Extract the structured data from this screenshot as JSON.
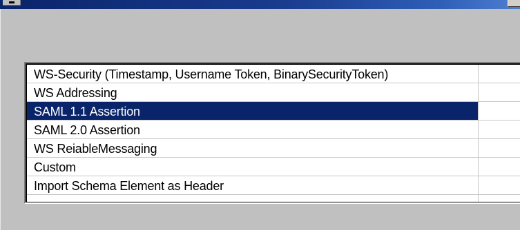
{
  "window": {
    "title_icon": "window-menu-icon"
  },
  "list": {
    "items": [
      {
        "label": "WS-Security (Timestamp, Username Token, BinarySecurityToken)",
        "selected": false
      },
      {
        "label": "WS Addressing",
        "selected": false
      },
      {
        "label": "SAML 1.1 Assertion",
        "selected": true
      },
      {
        "label": "SAML 2.0 Assertion",
        "selected": false
      },
      {
        "label": "WS ReiableMessaging",
        "selected": false
      },
      {
        "label": "Custom",
        "selected": false
      },
      {
        "label": "Import Schema Element as Header",
        "selected": false
      }
    ]
  },
  "colors": {
    "selection": "#0a246a",
    "background": "#c0c0c0",
    "titlebar": "#0a246a"
  }
}
